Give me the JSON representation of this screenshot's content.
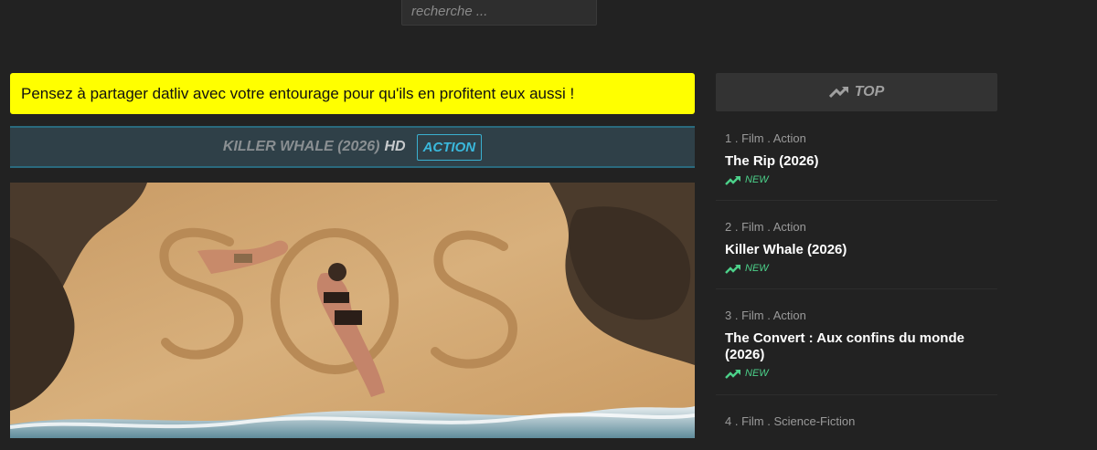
{
  "search": {
    "placeholder": "recherche ..."
  },
  "notice": {
    "text": "Pensez à partager datliv avec votre entourage pour qu'ils en profitent eux aussi !"
  },
  "movie": {
    "title": "KILLER WHALE (2026)",
    "quality": "HD",
    "genre": "ACTION"
  },
  "sidebar": {
    "header": "TOP",
    "items": [
      {
        "meta": "1 . Film . Action",
        "title": "The Rip (2026)",
        "badge": "NEW"
      },
      {
        "meta": "2 . Film . Action",
        "title": "Killer Whale (2026)",
        "badge": "NEW"
      },
      {
        "meta": "3 . Film . Action",
        "title": "The Convert : Aux confins du monde (2026)",
        "badge": "NEW"
      },
      {
        "meta": "4 . Film . Science-Fiction",
        "title": "",
        "badge": ""
      }
    ]
  },
  "colors": {
    "background": "#222222",
    "notice_bg": "#ffff00",
    "accent": "#3ab8dc",
    "new_badge": "#4cd18a"
  },
  "icons": {
    "top": "trending-up-icon",
    "new": "trending-up-icon"
  }
}
